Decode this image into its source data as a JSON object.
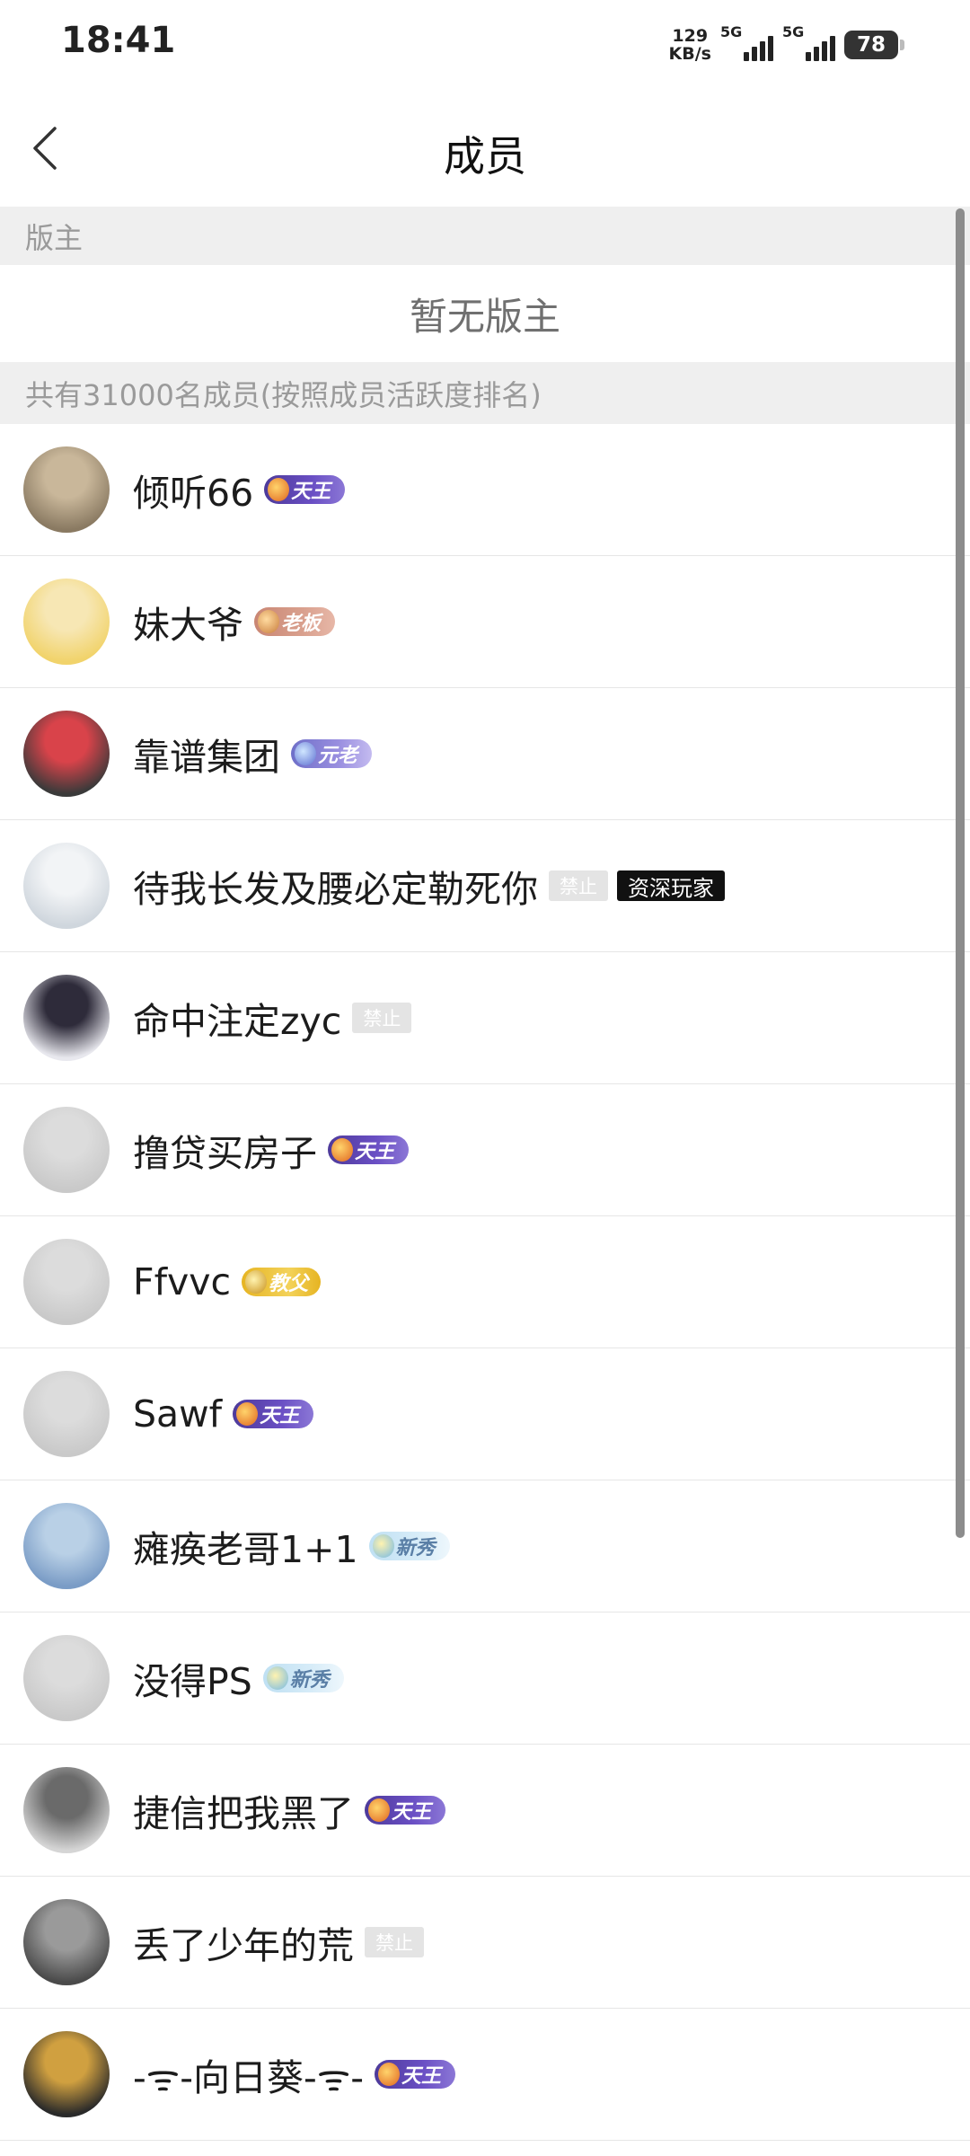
{
  "status": {
    "time": "18:41",
    "netspeed_value": "129",
    "netspeed_unit": "KB/s",
    "sim1": "5G",
    "sim2": "5G",
    "battery": "78"
  },
  "header": {
    "title": "成员",
    "back_icon": "chevron-left-icon"
  },
  "moderators": {
    "heading": "版主",
    "empty_text": "暂无版主"
  },
  "members": {
    "heading": "共有31000名成员(按照成员活跃度排名)",
    "items": [
      {
        "name": "倾听66",
        "level": "天王",
        "level_style": "purple",
        "avatar_colors": [
          "#8a7a62",
          "#c9b79a"
        ]
      },
      {
        "name": "妹大爷",
        "level": "老板",
        "level_style": "rose",
        "avatar_colors": [
          "#f1d36b",
          "#f7e7b4"
        ]
      },
      {
        "name": "靠谱集团",
        "level": "元老",
        "level_style": "violet",
        "avatar_colors": [
          "#3a3a3a",
          "#d9434a"
        ]
      },
      {
        "name": "待我长发及腰必定勒死你",
        "tags": [
          "禁止",
          "资深玩家"
        ],
        "avatar_colors": [
          "#cfd6dd",
          "#f2f4f6"
        ]
      },
      {
        "name": "命中注定zyc",
        "tags": [
          "禁止"
        ],
        "avatar_colors": [
          "#e8e8ee",
          "#2e2b3a"
        ]
      },
      {
        "name": "撸贷买房子",
        "level": "天王",
        "level_style": "purple",
        "avatar_colors": [
          "#c9c9c9",
          "#dcdcdc"
        ]
      },
      {
        "name": "Ffvvc",
        "level": "教父",
        "level_style": "gold",
        "avatar_colors": [
          "#c9c9c9",
          "#dcdcdc"
        ]
      },
      {
        "name": "Sawf",
        "level": "天王",
        "level_style": "purple",
        "avatar_colors": [
          "#c9c9c9",
          "#dcdcdc"
        ]
      },
      {
        "name": "瘫痪老哥1+1",
        "level": "新秀",
        "level_style": "sky",
        "avatar_colors": [
          "#7a9cc6",
          "#b9d0e6"
        ]
      },
      {
        "name": "没得PS",
        "level": "新秀",
        "level_style": "sky",
        "avatar_colors": [
          "#c9c9c9",
          "#dcdcdc"
        ]
      },
      {
        "name": "捷信把我黑了",
        "level": "天王",
        "level_style": "purple",
        "avatar_colors": [
          "#d5d5d5",
          "#6a6a6a"
        ]
      },
      {
        "name": "丢了少年的荒",
        "tags": [
          "禁止"
        ],
        "avatar_colors": [
          "#4a4a4a",
          "#9a9a9a"
        ]
      },
      {
        "name": "-ᯤ-向日葵-ᯤ-",
        "level": "天王",
        "level_style": "purple",
        "avatar_colors": [
          "#2a2a2a",
          "#d0a040"
        ]
      }
    ]
  }
}
